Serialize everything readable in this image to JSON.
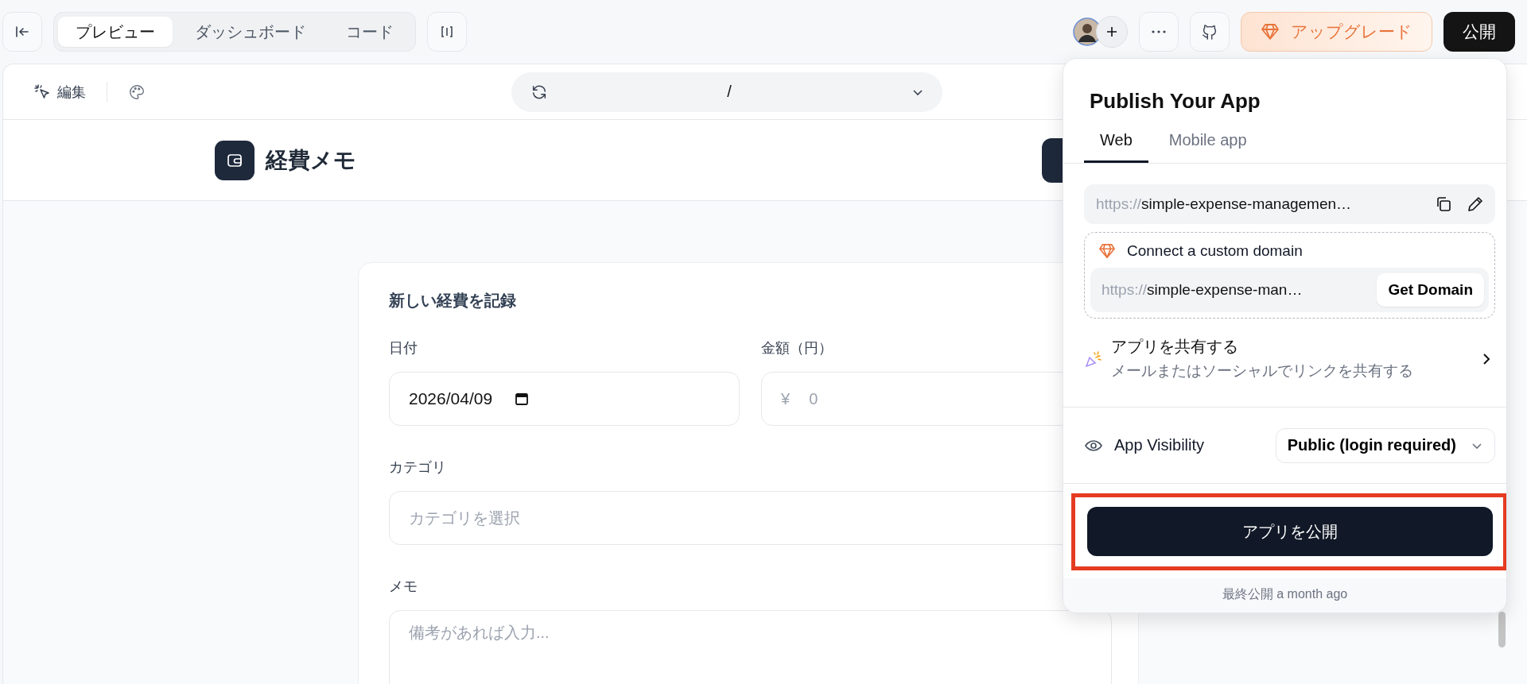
{
  "toolbar": {
    "tabs": [
      {
        "label": "プレビュー",
        "selected": true
      },
      {
        "label": "ダッシュボード",
        "selected": false
      },
      {
        "label": "コード",
        "selected": false
      }
    ],
    "upgrade": "アップグレード",
    "publish": "公開"
  },
  "preview_bar": {
    "edit": "編集",
    "path": "/"
  },
  "app": {
    "title": "経費メモ",
    "form": {
      "title": "新しい経費を記録",
      "fields": [
        {
          "kind": "date",
          "label": "日付",
          "value": "2026/04/09"
        },
        {
          "kind": "amount",
          "label": "金額（円）",
          "prefix": "¥",
          "placeholder": "0"
        },
        {
          "kind": "select",
          "label": "カテゴリ",
          "placeholder": "カテゴリを選択"
        },
        {
          "kind": "textarea",
          "label": "メモ",
          "placeholder": "備考があれば入力..."
        }
      ]
    }
  },
  "publish_panel": {
    "title": "Publish Your App",
    "tabs": [
      {
        "label": "Web",
        "selected": true
      },
      {
        "label": "Mobile app",
        "selected": false
      }
    ],
    "url": {
      "scheme": "https://",
      "host": "simple-expense-managemen…"
    },
    "custom_domain": {
      "title": "Connect a custom domain",
      "scheme": "https://",
      "host": "simple-expense-man…",
      "button": "Get Domain"
    },
    "share": {
      "title": "アプリを共有する",
      "subtitle": "メールまたはソーシャルでリンクを共有する"
    },
    "visibility": {
      "label": "App Visibility",
      "value": "Public (login required)"
    },
    "publish_button": {
      "label": "アプリを公開",
      "highlighted": true
    },
    "last_published": {
      "label": "最終公開",
      "time": "a month ago"
    }
  }
}
